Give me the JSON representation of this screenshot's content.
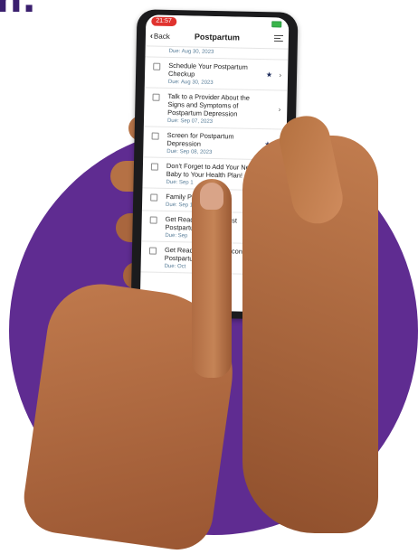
{
  "top_text": "n.",
  "colors": {
    "purple": "#5f2c91",
    "skin": "#b26a3f",
    "status_red": "#e0332f",
    "due_text": "#5a7f9a"
  },
  "status_bar": {
    "time": "21:57",
    "battery_icon": "battery-icon"
  },
  "nav": {
    "back_label": "Back",
    "back_icon": "chevron-left-icon",
    "title": "Postpartum",
    "filter_icon": "filter-list-icon"
  },
  "task_list": {
    "previous_due": "Due: Aug 30, 2023",
    "items": [
      {
        "title": "Schedule Your Postpartum Checkup",
        "due": "Due: Aug 30, 2023",
        "starred": true
      },
      {
        "title": "Talk to a Provider About the Signs and Symptoms of Postpartum Depression",
        "due": "Due: Sep 07, 2023",
        "starred": false
      },
      {
        "title": "Screen for Postpartum Depression",
        "due": "Due: Sep 08, 2023",
        "starred": true
      },
      {
        "title": "Don't Forget to Add Your New Baby to Your Health Plan!",
        "due": "Due: Sep 1",
        "starred": false
      },
      {
        "title": "Family Pl",
        "due": "Due: Sep 1",
        "starred": false
      },
      {
        "title": "Get Ready for Your First Postpartum Checkup",
        "due": "Due: Sep",
        "starred": false
      },
      {
        "title": "Get Ready for Your Second Postpartum Checkup",
        "due": "Due: Oct",
        "starred": false
      }
    ]
  }
}
